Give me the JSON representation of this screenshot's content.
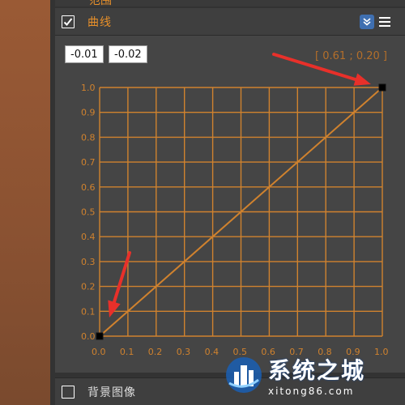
{
  "top_section": {
    "label": "范围"
  },
  "curve_section": {
    "checkbox_checked": true,
    "title": "曲线",
    "point_in": "-0.01",
    "point_out": "-0.02",
    "coord_readout": "[ 0.61 ; 0.20 ]"
  },
  "chart_data": {
    "type": "line",
    "x_ticks": [
      "0.0",
      "0.1",
      "0.2",
      "0.3",
      "0.4",
      "0.5",
      "0.6",
      "0.7",
      "0.8",
      "0.9",
      "1.0"
    ],
    "y_ticks": [
      "0.0",
      "0.1",
      "0.2",
      "0.3",
      "0.4",
      "0.5",
      "0.6",
      "0.7",
      "0.8",
      "0.9",
      "1.0"
    ],
    "xlim": [
      0,
      1
    ],
    "ylim": [
      0,
      1
    ],
    "grid": true,
    "series": [
      {
        "x": [
          0.0,
          1.0
        ],
        "y": [
          0.0,
          1.0
        ]
      }
    ],
    "control_points": [
      {
        "x": 0.0,
        "y": 0.0
      },
      {
        "x": 1.0,
        "y": 1.0
      }
    ]
  },
  "bottom_section": {
    "label": "背景图像",
    "checkbox_checked": false
  },
  "watermark": {
    "cn": "系统之城",
    "en": "xitong86.com"
  },
  "colors": {
    "accent": "#d0822e",
    "arrow": "#e8302a",
    "collapse": "#3f6fb0"
  }
}
